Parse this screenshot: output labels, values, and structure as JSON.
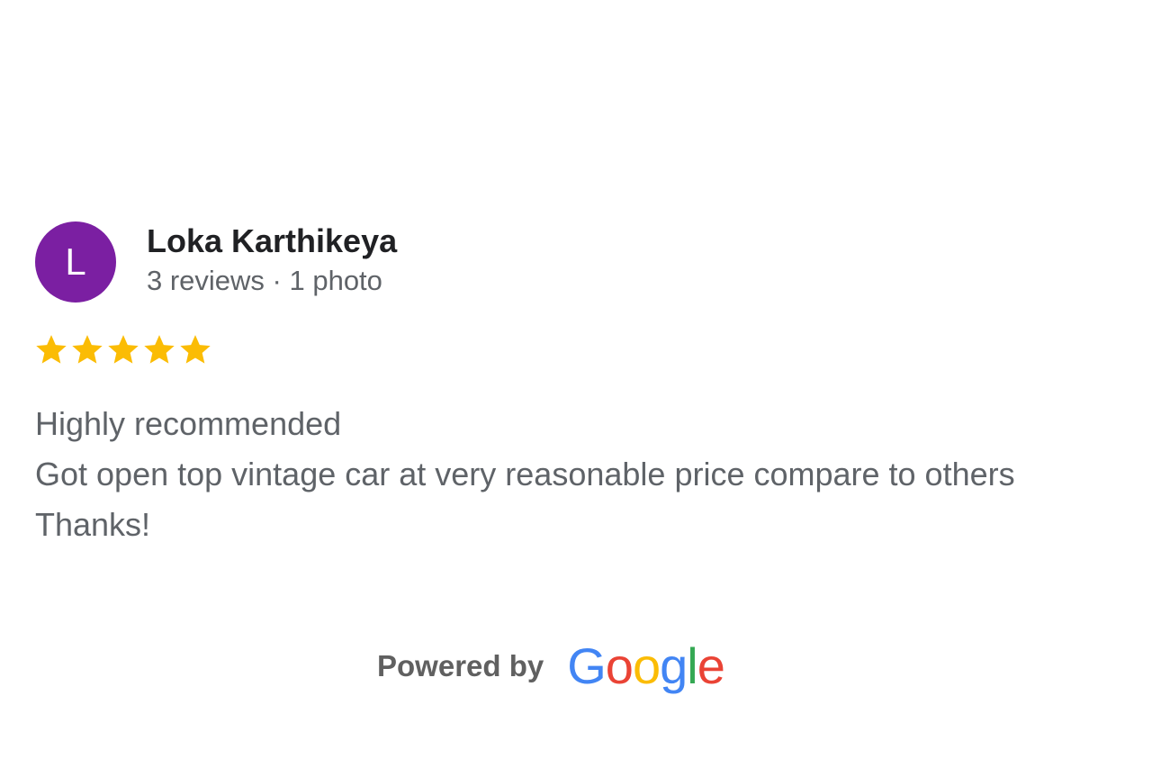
{
  "reviewer": {
    "initial": "L",
    "avatar_color": "#7b1fa2",
    "name": "Loka Karthikeya",
    "meta": "3 reviews · 1 photo"
  },
  "rating": {
    "value": 5,
    "max": 5,
    "star_color": "#fbbc04",
    "icon": "star-icon"
  },
  "review": {
    "lines": [
      "Highly recommended",
      "Got open top vintage car at very reasonable price compare to others",
      "Thanks!"
    ]
  },
  "footer": {
    "powered_by": "Powered by",
    "brand_letters": [
      {
        "char": "G",
        "color": "#4285f4"
      },
      {
        "char": "o",
        "color": "#ea4335"
      },
      {
        "char": "o",
        "color": "#fbbc05"
      },
      {
        "char": "g",
        "color": "#4285f4"
      },
      {
        "char": "l",
        "color": "#34a853"
      },
      {
        "char": "e",
        "color": "#ea4335"
      }
    ]
  }
}
